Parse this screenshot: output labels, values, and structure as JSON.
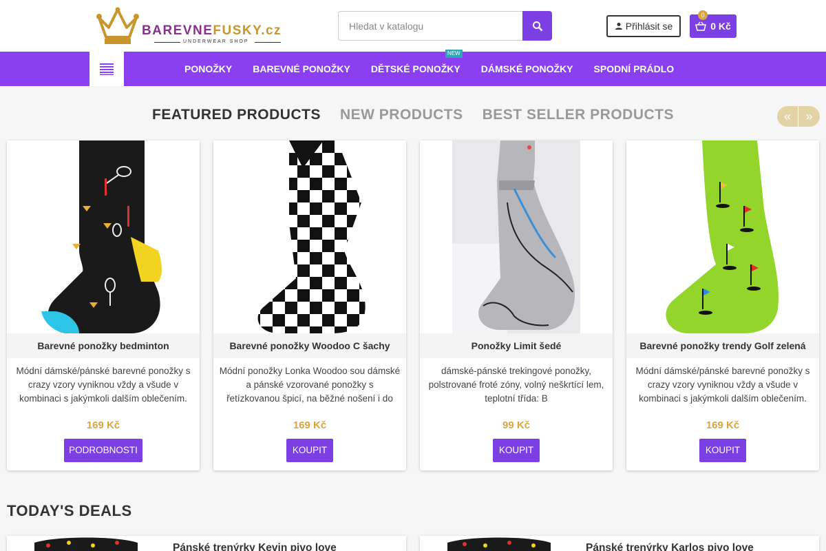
{
  "header": {
    "logo": {
      "brand_part1": "BAREVNE",
      "brand_part2": "FUSKY.cz",
      "tagline": "UNDERWEAR SHOP"
    },
    "search": {
      "placeholder": "Hledat v katalogu"
    },
    "login_label": "Přihlásit se",
    "cart": {
      "count": "0",
      "total": "0 Kč"
    }
  },
  "nav": {
    "items": [
      {
        "label": "PONOŽKY"
      },
      {
        "label": "BAREVNÉ PONOŽKY"
      },
      {
        "label": "DĚTSKÉ PONOŽKY",
        "badge": "NEW"
      },
      {
        "label": "DÁMSKÉ PONOŽKY"
      },
      {
        "label": "SPODNÍ PRÁDLO"
      }
    ]
  },
  "tabs": [
    {
      "label": "FEATURED PRODUCTS",
      "active": true
    },
    {
      "label": "NEW PRODUCTS",
      "active": false
    },
    {
      "label": "BEST SELLER PRODUCTS",
      "active": false
    }
  ],
  "products": [
    {
      "name": "Barevné ponožky bedminton",
      "description": "Módní dámské/pánské barevné ponožky s crazy vzory vyniknou vždy a všude v kombinaci s jakýmkoli dalším oblečením.",
      "price": "169 Kč",
      "button": "PODROBNOSTI"
    },
    {
      "name": "Barevné ponožky Woodoo C šachy",
      "description": "Módní ponožky Lonka Woodoo sou dámské a pánské vzorované ponožky s řetízkovanou špicí, na běžné nošení i do",
      "price": "169 Kč",
      "button": "KOUPIT"
    },
    {
      "name": "Ponožky Limit šedé",
      "description": "dámské-pánské trekingové ponožky, polstrované froté zóny, volný neškrtící lem, teplotní třída: B",
      "price": "99 Kč",
      "button": "KOUPIT"
    },
    {
      "name": "Barevné ponožky trendy Golf zelená",
      "description": "Módní dámské/pánské barevné ponožky s crazy vzory vyniknou vždy a všude v kombinaci s jakýmkoli dalším oblečením.",
      "price": "169 Kč",
      "button": "KOUPIT"
    }
  ],
  "deals": {
    "title": "TODAY'S DEALS",
    "items": [
      {
        "name": "Pánské trenýrky Kevin pivo love"
      },
      {
        "name": "Pánské trenýrky Karlos pivo love"
      }
    ]
  },
  "colors": {
    "accent": "#7b3fe4",
    "nav": "#8a3ff0",
    "price": "#d9a441",
    "badge": "#2aa7b4"
  }
}
